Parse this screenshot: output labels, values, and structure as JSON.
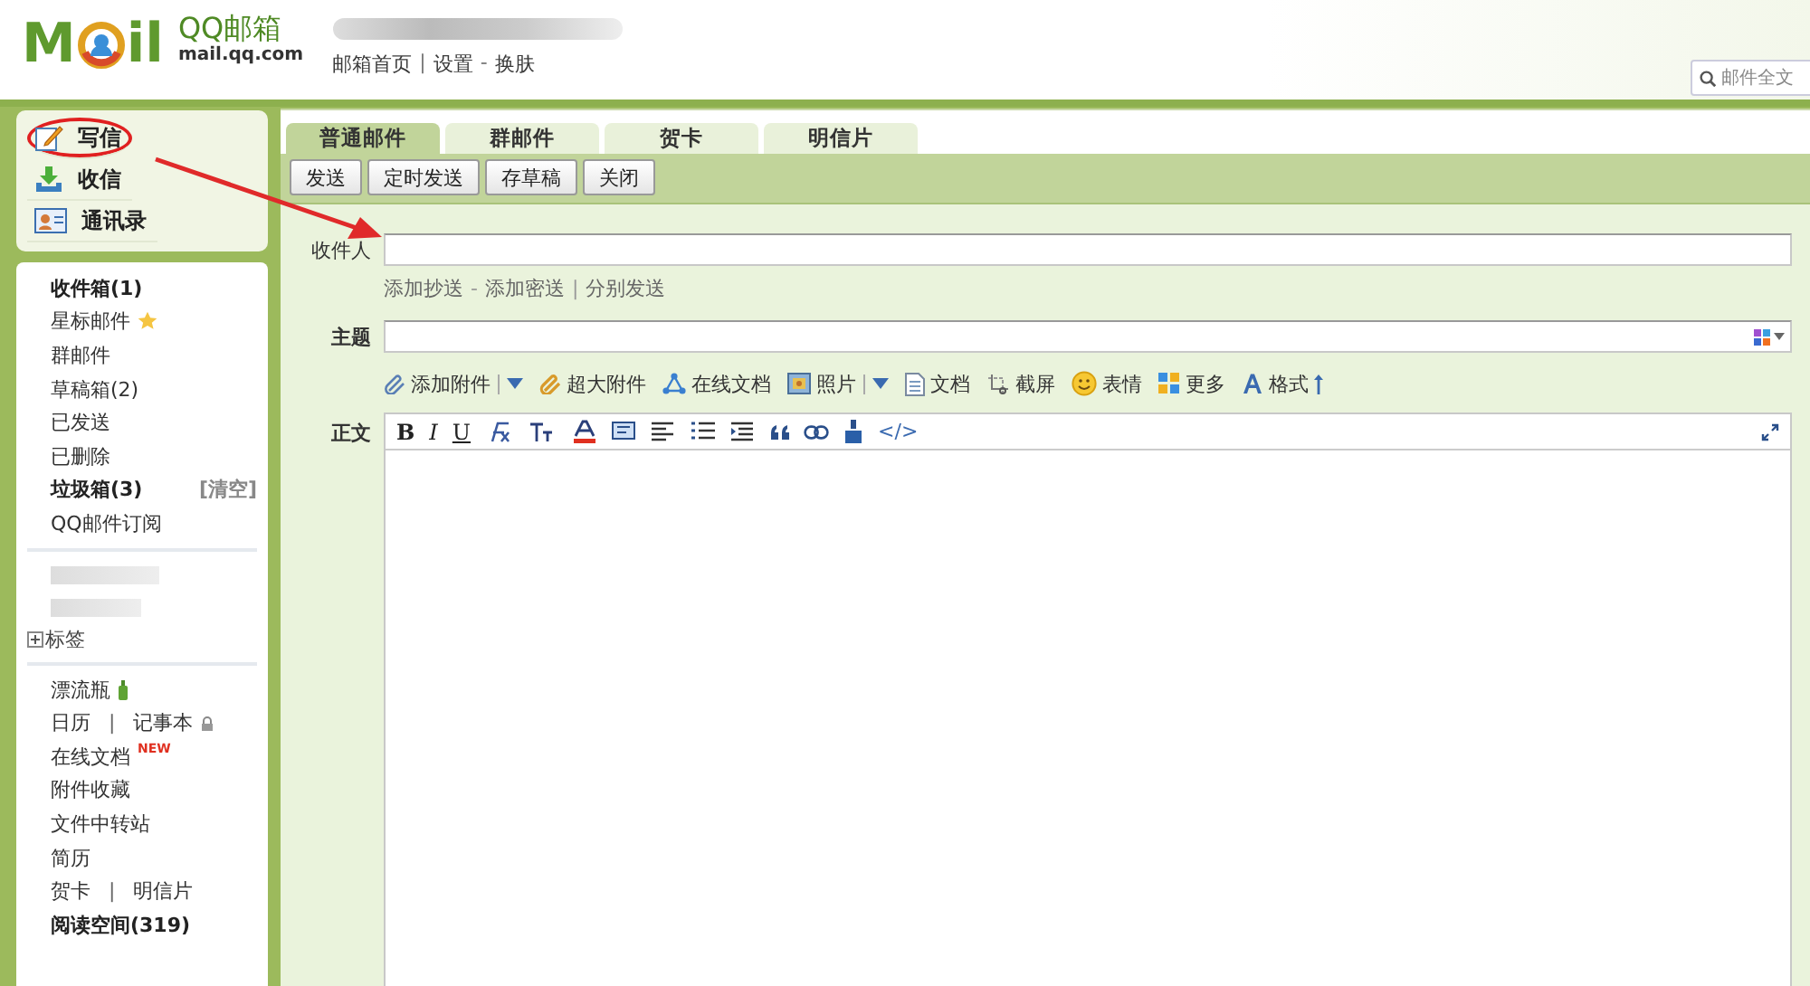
{
  "header": {
    "logo": {
      "left": "M",
      "right": "il"
    },
    "brand": "QQ邮箱",
    "domain": "mail.qq.com",
    "nav": [
      {
        "kind": "link",
        "text": "邮箱首页"
      },
      {
        "kind": "sep",
        "text": "|"
      },
      {
        "kind": "link",
        "text": "设置"
      },
      {
        "kind": "sep",
        "text": "-"
      },
      {
        "kind": "link",
        "text": "换肤"
      }
    ],
    "search": {
      "placeholder": "邮件全文"
    }
  },
  "sidebar": {
    "actions": [
      {
        "label": "写信",
        "circled": true
      },
      {
        "label": "收信",
        "circled": false
      },
      {
        "label": "通讯录",
        "circled": false
      }
    ],
    "folders": [
      {
        "label": "收件箱(1)",
        "unread": true
      },
      {
        "label": "星标邮件",
        "unread": false
      },
      {
        "label": "群邮件",
        "unread": false
      },
      {
        "label": "草稿箱(2)",
        "unread": false
      },
      {
        "label": "已发送",
        "unread": false
      },
      {
        "label": "已删除",
        "unread": false
      },
      {
        "label": "垃圾箱(3)",
        "unread": true,
        "action": "[清空]"
      },
      {
        "label": "QQ邮件订阅",
        "unread": false
      }
    ],
    "tags": {
      "label": "标签",
      "expanded": false
    },
    "tools": [
      {
        "items": [
          {
            "label": "漂流瓶",
            "unread": false
          }
        ]
      },
      {
        "separator": "|",
        "items": [
          {
            "label": "日历",
            "unread": false
          },
          {
            "label": "记事本",
            "unread": false
          }
        ]
      },
      {
        "items": [
          {
            "label": "在线文档",
            "unread": false,
            "badge": "NEW"
          }
        ]
      },
      {
        "items": [
          {
            "label": "附件收藏",
            "unread": false
          }
        ]
      },
      {
        "items": [
          {
            "label": "文件中转站",
            "unread": false
          }
        ]
      },
      {
        "items": [
          {
            "label": "简历",
            "unread": false
          }
        ]
      },
      {
        "separator": "|",
        "items": [
          {
            "label": "贺卡",
            "unread": false
          },
          {
            "label": "明信片",
            "unread": false
          }
        ]
      },
      {
        "items": [
          {
            "label": "阅读空间(319)",
            "unread": true
          }
        ]
      }
    ]
  },
  "compose": {
    "tabs": [
      {
        "label": "普通邮件",
        "selected": true
      },
      {
        "label": "群邮件",
        "selected": false
      },
      {
        "label": "贺卡",
        "selected": false
      },
      {
        "label": "明信片",
        "selected": false
      }
    ],
    "buttons": [
      "发送",
      "定时发送",
      "存草稿",
      "关闭"
    ],
    "recipient": {
      "label": "收件人"
    },
    "recipient_links": [
      {
        "kind": "link",
        "text": "添加抄送"
      },
      {
        "kind": "sep",
        "text": "-"
      },
      {
        "kind": "link",
        "text": "添加密送"
      },
      {
        "kind": "sep",
        "text": "|"
      },
      {
        "kind": "link",
        "text": "分别发送"
      }
    ],
    "subject": {
      "label": "主题"
    },
    "attach_tools": [
      {
        "label": "添加附件",
        "dropdown": true
      },
      {
        "label": "超大附件",
        "dropdown": false
      },
      {
        "label": "在线文档",
        "dropdown": false
      },
      {
        "label": "照片",
        "dropdown": true
      },
      {
        "label": "文档",
        "dropdown": false
      },
      {
        "label": "截屏",
        "dropdown": false
      },
      {
        "label": "表情",
        "dropdown": false
      },
      {
        "label": "更多",
        "dropdown": false
      },
      {
        "label": "格式",
        "dropdown": false
      }
    ],
    "body": {
      "label": "正文",
      "format_tools": [
        {
          "kind": "bold",
          "text": "B"
        },
        {
          "kind": "italic",
          "text": "I"
        },
        {
          "kind": "underline",
          "text": "U"
        },
        {
          "kind": "fontface"
        },
        {
          "kind": "fontsize"
        },
        {
          "kind": "fontcolor"
        },
        {
          "kind": "bgcolor"
        },
        {
          "kind": "align"
        },
        {
          "kind": "list"
        },
        {
          "kind": "indent"
        },
        {
          "kind": "quote"
        },
        {
          "kind": "link"
        },
        {
          "kind": "clear"
        },
        {
          "kind": "code",
          "text": "</>"
        }
      ]
    }
  },
  "annotation": {
    "arrow": true
  }
}
